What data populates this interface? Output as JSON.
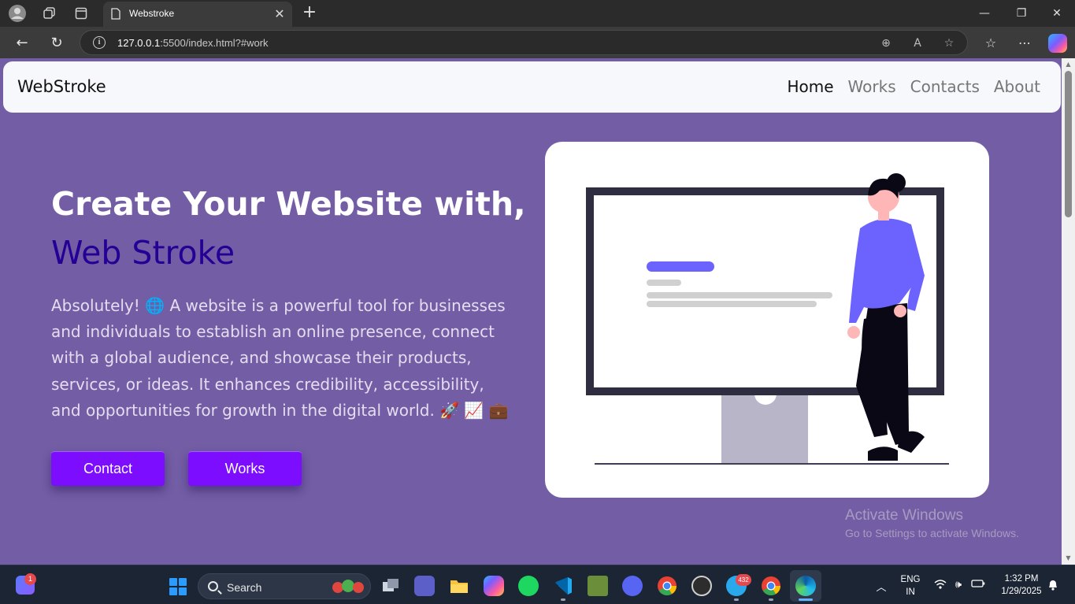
{
  "browser": {
    "tab_title": "Webstroke",
    "url_host": "127.0.0.1",
    "url_rest": ":5500/index.html?#work"
  },
  "site": {
    "brand": "WebStroke",
    "nav": [
      "Home",
      "Works",
      "Contacts",
      "About"
    ],
    "active_nav": "Home",
    "hero": {
      "title": "Create Your Website with,",
      "subtitle": "Web Stroke",
      "text": "Absolutely! 🌐 A website is a powerful tool for businesses and individuals to establish an online presence, connect with a global audience, and showcase their products, services, or ideas. It enhances credibility, accessibility, and opportunities for growth in the digital world. 🚀 📈 💼",
      "buttons": {
        "contact": "Contact",
        "works": "Works"
      }
    },
    "colors": {
      "page_bg": "#735ea6",
      "subtitle": "#240094",
      "button": "#7c0dff",
      "illustration_accent": "#6c63ff"
    }
  },
  "watermark": {
    "line1": "Activate Windows",
    "line2": "Go to Settings to activate Windows."
  },
  "taskbar": {
    "widget_badge": "1",
    "search_label": "Search",
    "telegram_badge": "432",
    "lang_top": "ENG",
    "lang_bottom": "IN",
    "time": "1:32 PM",
    "date": "1/29/2025",
    "apps": [
      "task-view",
      "teams",
      "file-explorer",
      "copilot",
      "spotify",
      "vscode",
      "minecraft",
      "discord",
      "chrome",
      "obs",
      "telegram",
      "chrome-profile",
      "edge"
    ]
  }
}
